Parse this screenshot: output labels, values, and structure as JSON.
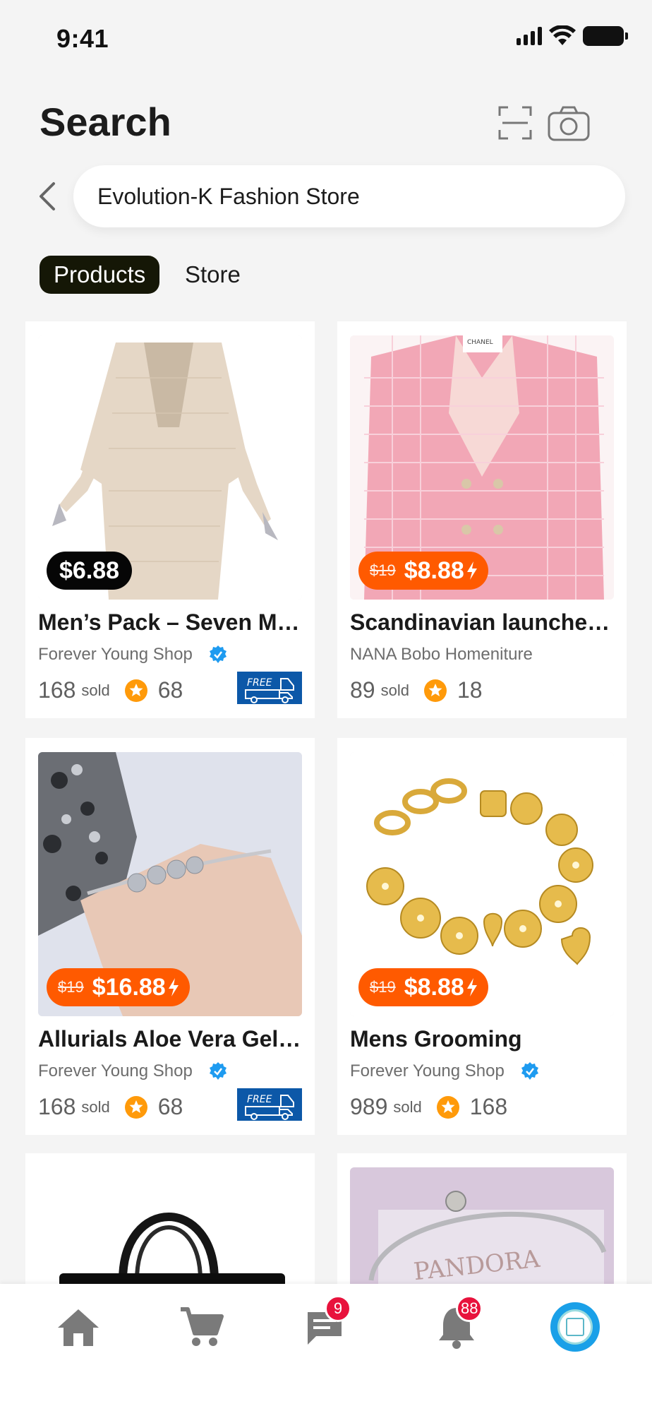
{
  "status": {
    "time": "9:41"
  },
  "header": {
    "title": "Search"
  },
  "search": {
    "value": "Evolution-K Fashion Store"
  },
  "tabs": [
    {
      "label": "Products",
      "active": true
    },
    {
      "label": "Store",
      "active": false
    }
  ],
  "products": [
    {
      "title": "Men’s Pack – Seven Min...",
      "shop": "Forever Young Shop",
      "verified": true,
      "price": "$6.88",
      "old_price": "",
      "sold": "168",
      "sold_label": "sold",
      "rating": "68",
      "free_shipping": true,
      "free_label": "FREE"
    },
    {
      "title": "Scandinavian launches ...",
      "shop": "NANA Bobo Homeniture",
      "verified": false,
      "price": "$8.88",
      "old_price": "$19",
      "sold": "89",
      "sold_label": "sold",
      "rating": "18",
      "free_shipping": false,
      "label_on_image": "CHANEL"
    },
    {
      "title": "Allurials Aloe Vera Gel fo...",
      "shop": "Forever Young Shop",
      "verified": true,
      "price": "$16.88",
      "old_price": "$19",
      "sold": "168",
      "sold_label": "sold",
      "rating": "68",
      "free_shipping": true,
      "free_label": "FREE"
    },
    {
      "title": "Mens Grooming",
      "shop": "Forever Young Shop",
      "verified": true,
      "price": "$8.88",
      "old_price": "$19",
      "sold": "989",
      "sold_label": "sold",
      "rating": "168",
      "free_shipping": false
    },
    {
      "title": "",
      "shop": "",
      "partial": true
    },
    {
      "title": "",
      "shop": "",
      "partial": true,
      "label_on_image": "PANDORA"
    }
  ],
  "nav": {
    "items": [
      "home-icon",
      "cart-icon",
      "chat-icon",
      "bell-icon",
      "avatar"
    ],
    "chat_badge": "9",
    "notifications_badge": "88"
  },
  "colors": {
    "accent": "#ff5a00",
    "tab_active": "#151706",
    "badge": "#e8123c",
    "verified": "#1e9bf0",
    "star": "#ff9a0a",
    "free_badge": "#0c58a8"
  }
}
